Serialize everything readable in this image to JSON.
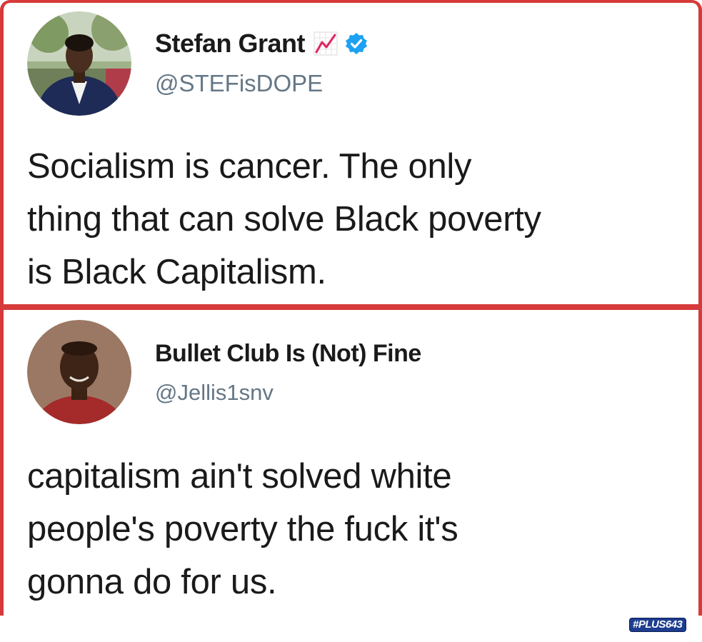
{
  "tweets": [
    {
      "display_name": "Stefan Grant",
      "handle": "@STEFisDOPE",
      "badge_icon": "trending-chart-icon",
      "verified": true,
      "text": "Socialism is cancer. The only\nthing that can solve Black poverty\nis Black Capitalism."
    },
    {
      "display_name": "Bullet Club Is (Not) Fine",
      "handle": "@Jellis1snv",
      "verified": false,
      "text": "capitalism ain't solved white\npeople's poverty the fuck it's\ngonna do for us."
    }
  ],
  "watermark": {
    "text": "#PLUS643"
  },
  "colors": {
    "frame": "#d63a3a",
    "handle": "#657786",
    "verified": "#1da1f2",
    "text": "#1a1a1a",
    "watermark_bg": "#1d3d8f"
  }
}
